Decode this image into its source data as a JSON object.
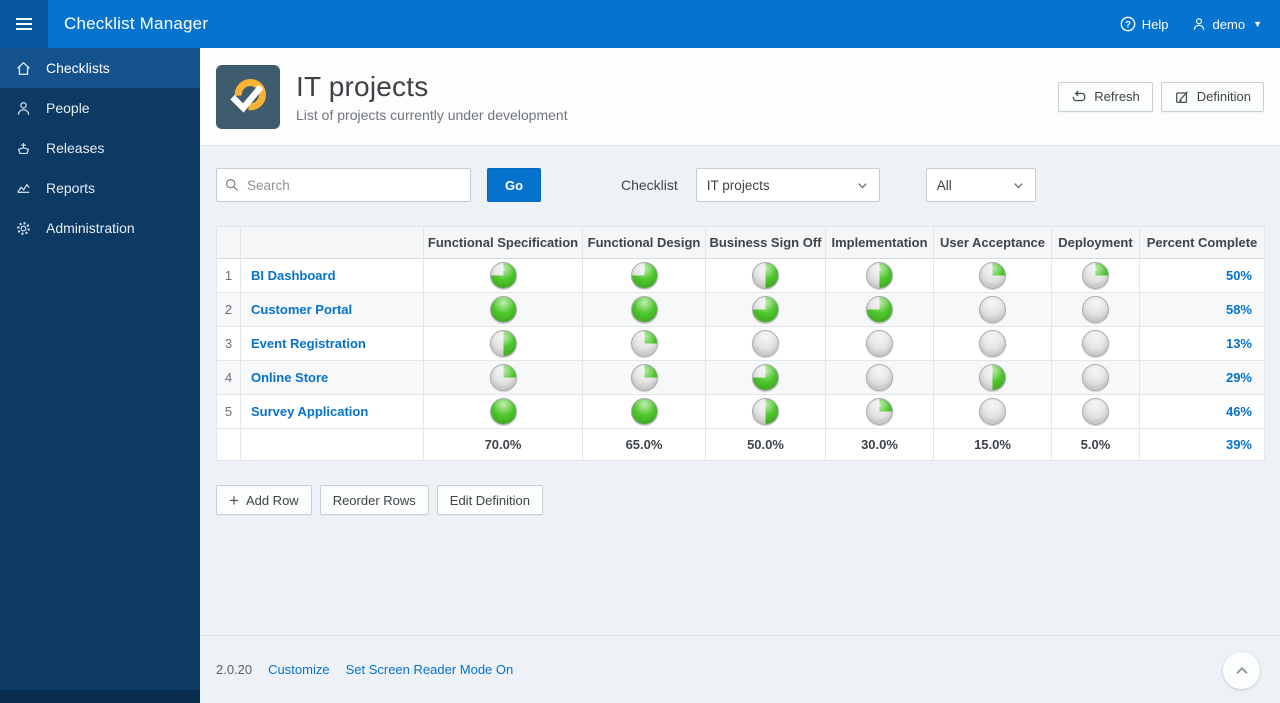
{
  "app": {
    "title": "Checklist Manager",
    "help_label": "Help",
    "user_label": "demo"
  },
  "sidebar": {
    "items": [
      {
        "label": "Checklists",
        "icon": "home-icon",
        "active": true
      },
      {
        "label": "People",
        "icon": "person-icon",
        "active": false
      },
      {
        "label": "Releases",
        "icon": "ship-icon",
        "active": false
      },
      {
        "label": "Reports",
        "icon": "chart-icon",
        "active": false
      },
      {
        "label": "Administration",
        "icon": "gear-icon",
        "active": false
      }
    ]
  },
  "page": {
    "title": "IT projects",
    "subtitle": "List of projects currently under development",
    "refresh_label": "Refresh",
    "definition_label": "Definition"
  },
  "filters": {
    "search_placeholder": "Search",
    "go_label": "Go",
    "checklist_label": "Checklist",
    "checklist_value": "IT projects",
    "status_value": "All"
  },
  "table": {
    "columns": [
      "Functional Specification",
      "Functional Design",
      "Business Sign Off",
      "Implementation",
      "User Acceptance",
      "Deployment",
      "Percent Complete"
    ],
    "rows": [
      {
        "num": "1",
        "name": "BI Dashboard",
        "values": [
          75,
          75,
          50,
          50,
          25,
          25
        ],
        "percent_complete": "50%"
      },
      {
        "num": "2",
        "name": "Customer Portal",
        "values": [
          100,
          100,
          75,
          75,
          0,
          0
        ],
        "percent_complete": "58%"
      },
      {
        "num": "3",
        "name": "Event Registration",
        "values": [
          50,
          25,
          0,
          0,
          0,
          0
        ],
        "percent_complete": "13%"
      },
      {
        "num": "4",
        "name": "Online Store",
        "values": [
          25,
          25,
          75,
          0,
          50,
          0
        ],
        "percent_complete": "29%"
      },
      {
        "num": "5",
        "name": "Survey Application",
        "values": [
          100,
          100,
          50,
          25,
          0,
          0
        ],
        "percent_complete": "46%"
      }
    ],
    "totals": {
      "values": [
        "70.0%",
        "65.0%",
        "50.0%",
        "30.0%",
        "15.0%",
        "5.0%"
      ],
      "percent_complete": "39%"
    }
  },
  "actions": {
    "add_row_label": "Add Row",
    "reorder_rows_label": "Reorder Rows",
    "edit_definition_label": "Edit Definition"
  },
  "footer": {
    "version": "2.0.20",
    "customize_label": "Customize",
    "screen_reader_label": "Set Screen Reader Mode On"
  },
  "colors": {
    "header_blue": "#0673cf",
    "sidebar_navy": "#0c3a63",
    "sidebar_active": "#15518d",
    "link_blue": "#0572ce",
    "pie_green": "#4ec72b",
    "pie_gray": "#e4e5e4",
    "icon_amber": "#f9b233",
    "icon_slate": "#3f5b6e"
  }
}
